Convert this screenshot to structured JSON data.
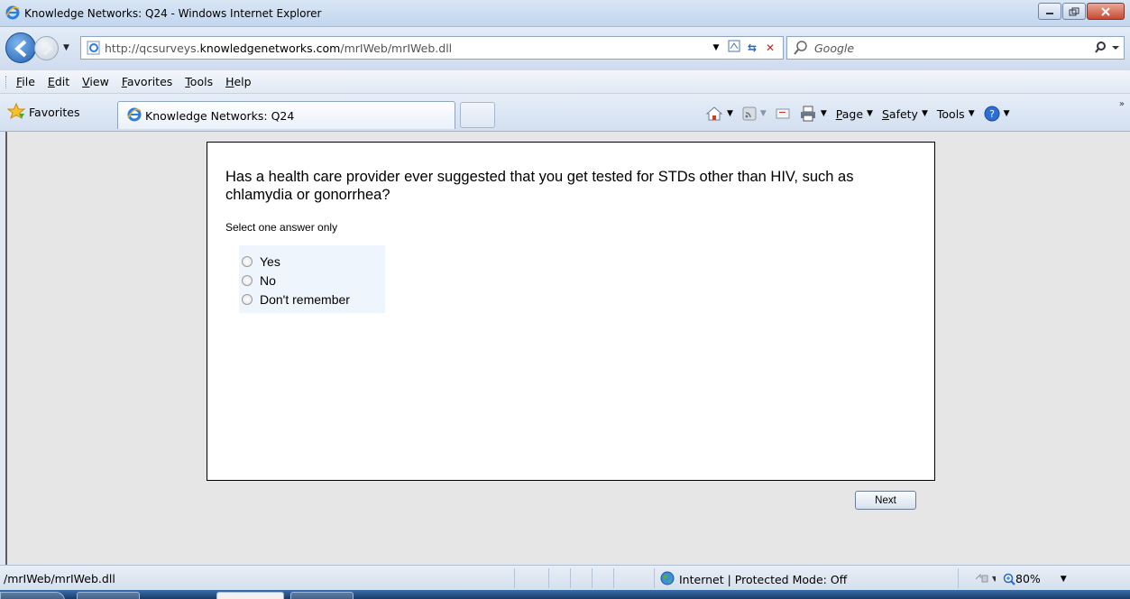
{
  "window": {
    "title": "Knowledge Networks: Q24 - Windows Internet Explorer",
    "minimize_icon": "minimize-icon",
    "maximize_icon": "restore-icon",
    "close_icon": "close-icon"
  },
  "address": {
    "url_prefix": "http://qcsurveys.",
    "url_domain": "knowledgenetworks.com",
    "url_path": "/mrIWeb/mrIWeb.dll",
    "search_placeholder": "Google"
  },
  "menu": {
    "items": [
      "File",
      "Edit",
      "View",
      "Favorites",
      "Tools",
      "Help"
    ]
  },
  "favorites_bar": {
    "favorites_label": "Favorites",
    "tab_title": "Knowledge Networks: Q24",
    "commands": {
      "page": "Page",
      "safety": "Safety",
      "tools": "Tools"
    }
  },
  "survey": {
    "question": "Has a health care provider ever suggested that you get tested for STDs other than HIV, such as chlamydia or gonorrhea?",
    "instruction": "Select one answer only",
    "options": [
      "Yes",
      "No",
      "Don't remember"
    ],
    "next_label": "Next"
  },
  "status": {
    "text": "/mrIWeb/mrIWeb.dll",
    "zone": "Internet | Protected Mode: Off",
    "zoom": "80%"
  },
  "colors": {
    "accent": "#1f5fb0",
    "content_bg": "#e6e6e6",
    "options_bg": "#eef5fd"
  }
}
